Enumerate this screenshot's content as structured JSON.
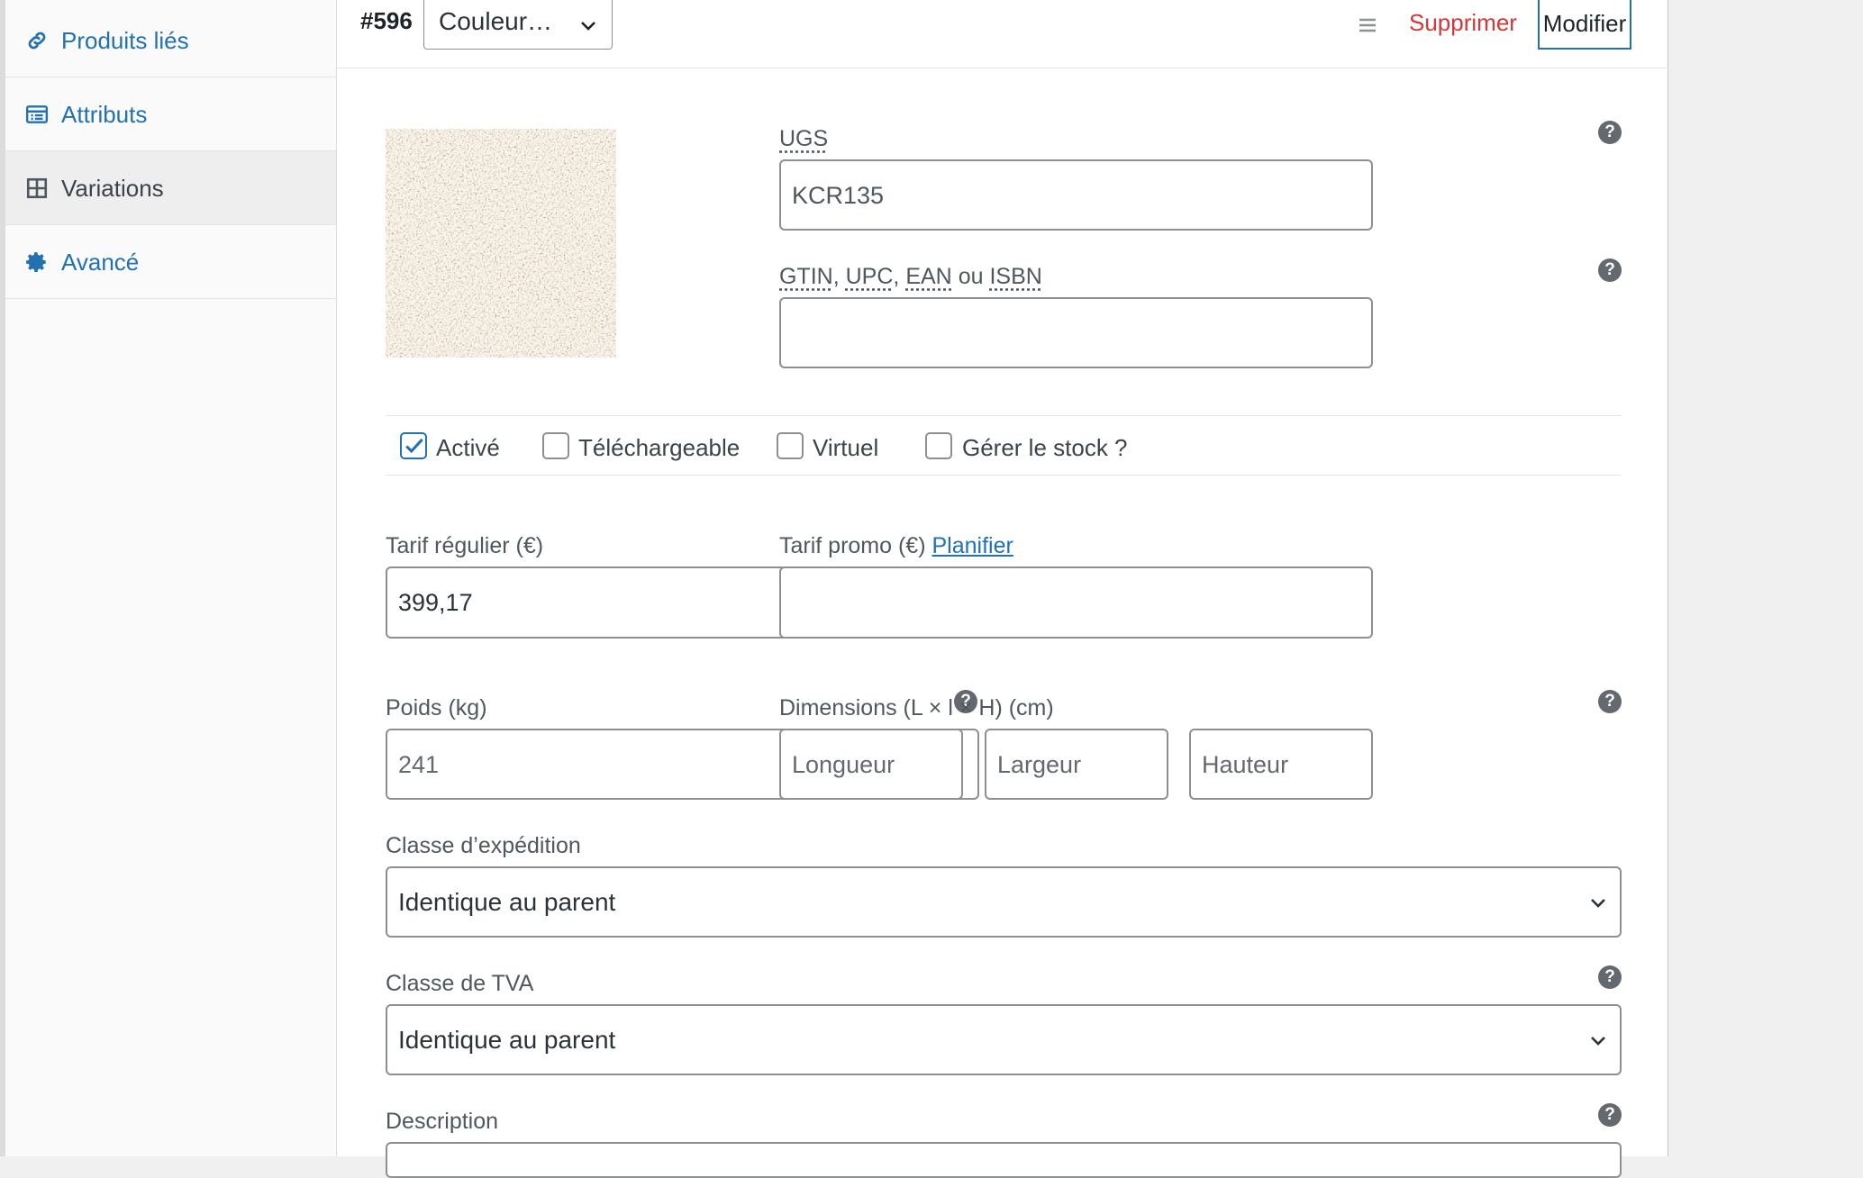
{
  "sidebar": {
    "tabs": [
      {
        "label": "Produits liés",
        "icon": "link-icon"
      },
      {
        "label": "Attributs",
        "icon": "list-view-icon"
      },
      {
        "label": "Variations",
        "icon": "grid-icon",
        "active": true
      },
      {
        "label": "Avancé",
        "icon": "gear-icon"
      }
    ]
  },
  "variation": {
    "id": "#596",
    "attribute_value": "Couleur…",
    "delete_label": "Supprimer",
    "edit_label": "Modifier"
  },
  "fields": {
    "sku_label": "UGS",
    "sku_value": "KCR135",
    "gtin_label_gtin": "GTIN",
    "gtin_label_upc": "UPC",
    "gtin_label_ean": "EAN",
    "gtin_label_ou": "ou",
    "gtin_label_isbn": "ISBN",
    "gtin_value": "",
    "enabled_label": "Activé",
    "enabled_checked": true,
    "downloadable_label": "Téléchargeable",
    "virtual_label": "Virtuel",
    "manage_stock_label": "Gérer le stock ?",
    "regular_price_label": "Tarif régulier (€)",
    "regular_price_value": "399,17",
    "sale_price_label": "Tarif promo (€)",
    "schedule_link": "Planifier",
    "sale_price_value": "",
    "weight_label": "Poids (kg)",
    "weight_placeholder": "241",
    "dimensions_label": "Dimensions (L × l × H) (cm)",
    "length_placeholder": "Longueur",
    "width_placeholder": "Largeur",
    "height_placeholder": "Hauteur",
    "shipping_class_label": "Classe d’expédition",
    "shipping_class_value": "Identique au parent",
    "tax_class_label": "Classe de TVA",
    "tax_class_value": "Identique au parent",
    "description_label": "Description"
  },
  "colors": {
    "accent": "#2271b1",
    "danger": "#d63638",
    "border": "#8c8f94"
  }
}
